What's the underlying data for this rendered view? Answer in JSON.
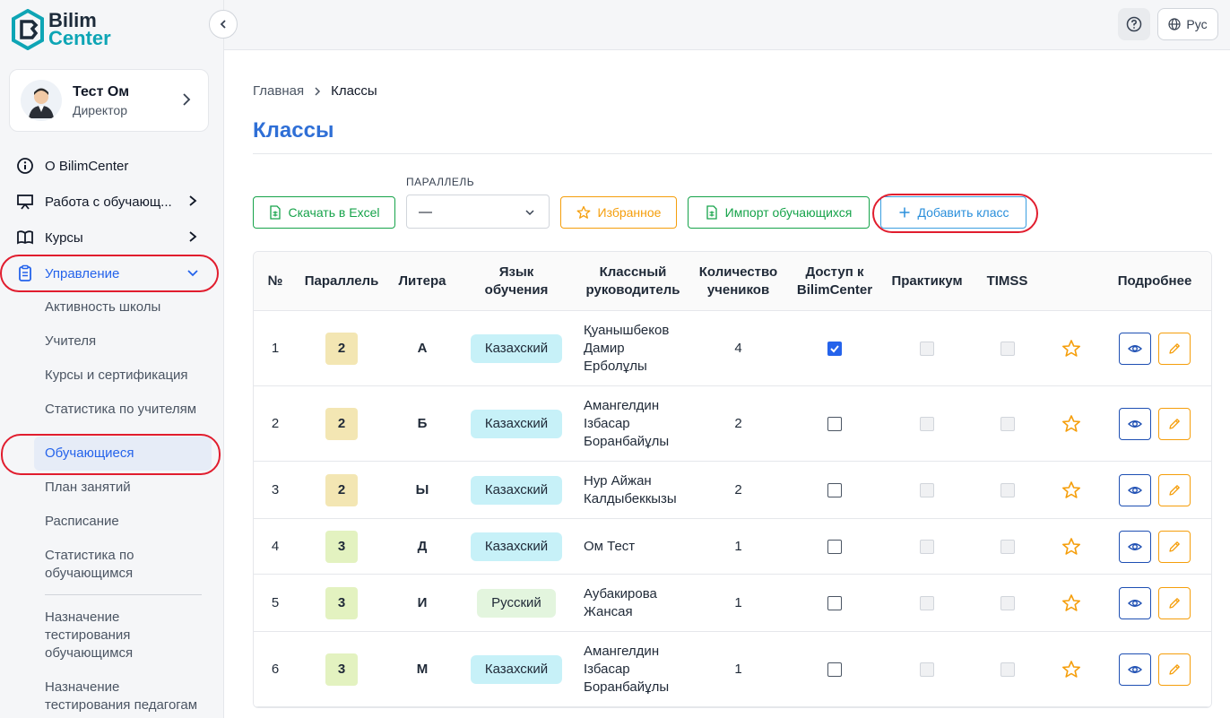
{
  "brand": {
    "line1": "Bilim",
    "line2": "Center"
  },
  "profile": {
    "name": "Тест Ом",
    "role": "Директор"
  },
  "nav": {
    "about": "О BilimCenter",
    "students_work": "Работа с обучающ...",
    "courses": "Курсы",
    "management": "Управление"
  },
  "subnav": {
    "school_activity": "Активность школы",
    "teachers": "Учителя",
    "courses_cert": "Курсы и сертификация",
    "teacher_stats": "Статистика по учителям",
    "students": "Обучающиеся",
    "lesson_plan": "План занятий",
    "schedule": "Расписание",
    "student_stats": "Статистика по обучающимся",
    "assign_test_students": "Назначение тестирования обучающимся",
    "assign_test_teachers": "Назначение тестирования педагогам"
  },
  "topbar": {
    "lang": "Рус"
  },
  "breadcrumb": {
    "home": "Главная",
    "current": "Классы"
  },
  "page_title": "Классы",
  "toolbar": {
    "excel": "Скачать в Excel",
    "filter_label": "ПАРАЛЛЕЛЬ",
    "filter_value": "—",
    "favorites": "Избранное",
    "import": "Импорт обучающихся",
    "add_class": "Добавить класс"
  },
  "table": {
    "headers": {
      "num": "№",
      "parallel": "Параллель",
      "letter": "Литера",
      "language": "Язык обучения",
      "teacher": "Классный руководитель",
      "count": "Количество учеников",
      "access": "Доступ к BilimCenter",
      "practicum": "Практикум",
      "timss": "TIMSS",
      "details": "Подробнее"
    },
    "rows": [
      {
        "num": "1",
        "parallel": "2",
        "letter": "А",
        "language": "Казахский",
        "teacher": "Қуанышбеков Дамир Ерболұлы",
        "count": "4",
        "access": true
      },
      {
        "num": "2",
        "parallel": "2",
        "letter": "Б",
        "language": "Казахский",
        "teacher": "Амангелдин Ізбасар Боранбайұлы",
        "count": "2",
        "access": false
      },
      {
        "num": "3",
        "parallel": "2",
        "letter": "Ы",
        "language": "Казахский",
        "teacher": "Нур Айжан Калдыбеккызы",
        "count": "2",
        "access": false
      },
      {
        "num": "4",
        "parallel": "3",
        "letter": "Д",
        "language": "Казахский",
        "teacher": "Ом Тест",
        "count": "1",
        "access": false
      },
      {
        "num": "5",
        "parallel": "3",
        "letter": "И",
        "language": "Русский",
        "teacher": "Аубакирова Жансая",
        "count": "1",
        "access": false
      },
      {
        "num": "6",
        "parallel": "3",
        "letter": "М",
        "language": "Казахский",
        "teacher": "Амангелдин Ізбасар Боранбайұлы",
        "count": "1",
        "access": false
      }
    ]
  },
  "colors": {
    "accent": "#2f6fd6",
    "parallel_2": "#f3e6b3",
    "parallel_3": "#e3f2c0",
    "lang_kazakh": "#c7f1f8",
    "lang_russian": "#e3f5de",
    "highlight_ring": "#e11d2e"
  },
  "icons": {
    "about": "info-circle-icon",
    "students_work": "presentation-board-icon",
    "courses": "open-book-icon",
    "management": "clipboard-icon",
    "favorite": "star-icon",
    "view": "eye-icon",
    "edit": "pencil-icon"
  }
}
